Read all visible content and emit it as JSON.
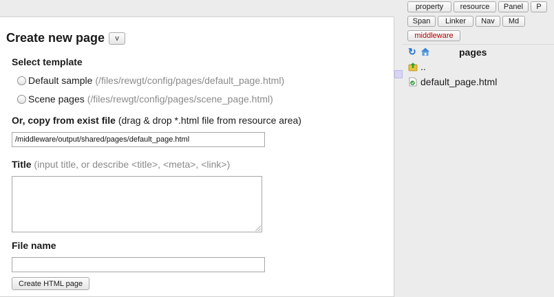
{
  "editor": {
    "heading": "Create new page",
    "toggle_label": "v",
    "select_template_label": "Select template",
    "templates": [
      {
        "label": "Default sample",
        "path": "(/files/rewgt/config/pages/default_page.html)"
      },
      {
        "label": "Scene pages",
        "path": "(/files/rewgt/config/pages/scene_page.html)"
      }
    ],
    "copy_label": "Or, copy from exist file",
    "copy_hint": "(drag & drop *.html file from resource area)",
    "copy_value": "/middleware/output/shared/pages/default_page.html",
    "title_label": "Title",
    "title_hint": "(input title, or describe <title>, <meta>, <link>)",
    "title_value": "",
    "filename_label": "File name",
    "filename_value": "",
    "create_button": "Create HTML page"
  },
  "right_panel": {
    "tabs": [
      "property",
      "resource",
      "Panel",
      "P",
      "Span",
      "Linker",
      "Nav",
      "Md",
      "middleware"
    ],
    "active_tab": "middleware",
    "active_color": "#b00000",
    "pages_title": "pages",
    "items": [
      {
        "name": "..",
        "icon": "folder-up-icon"
      },
      {
        "name": "default_page.html",
        "icon": "html-file-icon"
      }
    ]
  },
  "colors": {
    "accent": "#0a26d8",
    "hint": "#8a8a8a",
    "panel_bg": "#ececec"
  }
}
